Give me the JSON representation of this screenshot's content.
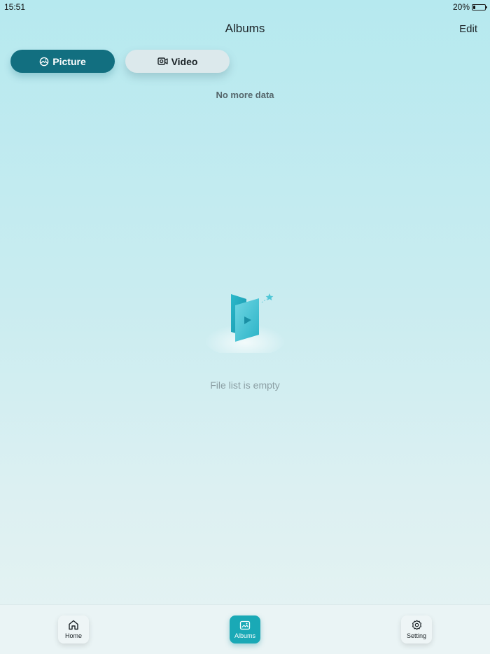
{
  "status_bar": {
    "time": "15:51",
    "battery_percent": "20%",
    "battery_level": 0.2
  },
  "nav": {
    "title": "Albums",
    "edit_label": "Edit"
  },
  "tabs": [
    {
      "label": "Picture",
      "icon": "picture-icon",
      "active": true
    },
    {
      "label": "Video",
      "icon": "video-icon",
      "active": false
    }
  ],
  "list": {
    "footer_text": "No more data",
    "empty_text": "File list is empty"
  },
  "tabbar": {
    "items": [
      {
        "label": "Home",
        "icon": "home-icon",
        "active": false
      },
      {
        "label": "Albums",
        "icon": "albums-icon",
        "active": true
      },
      {
        "label": "Setting",
        "icon": "gear-icon",
        "active": false
      }
    ]
  },
  "colors": {
    "accent": "#126f80",
    "tab_active_bg": "#1aa9b6",
    "background_top": "#b6e9ef",
    "background_bottom": "#e6f3f3"
  }
}
